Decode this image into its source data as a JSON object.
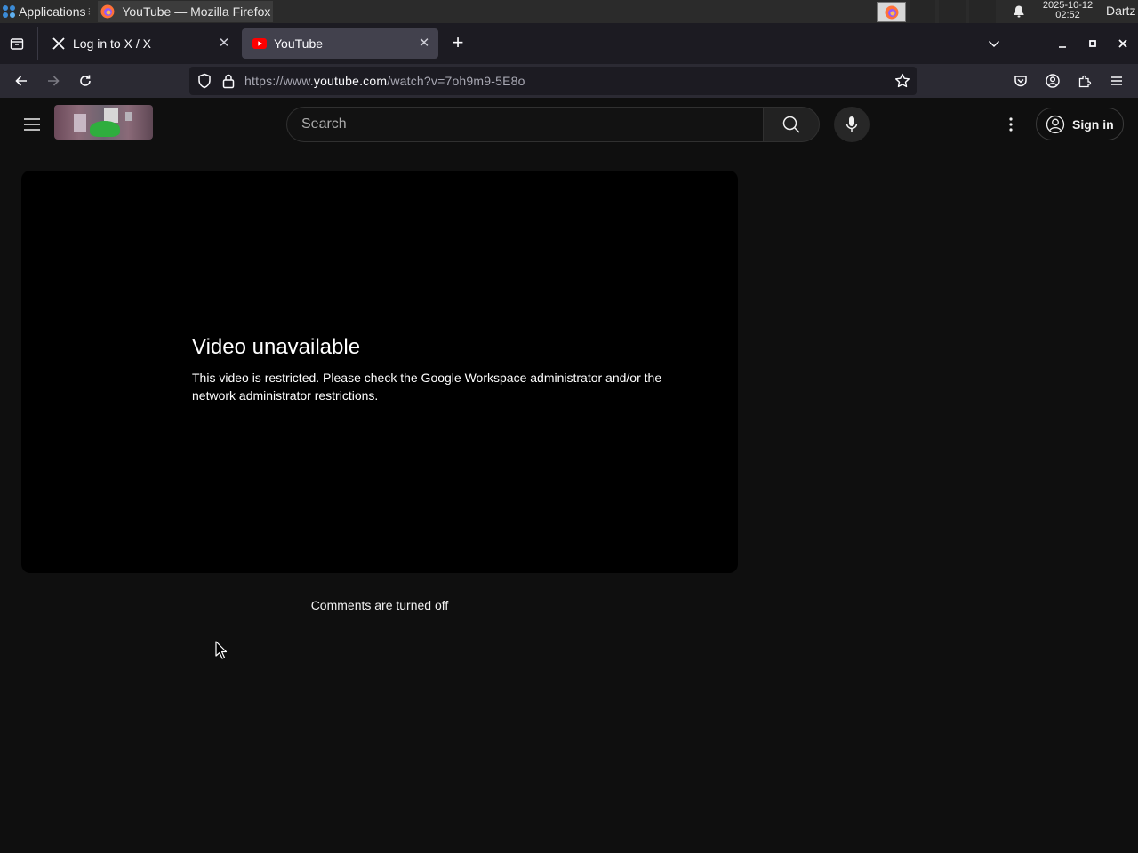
{
  "taskbar": {
    "applications_label": "Applications",
    "applications_sep": "⁝",
    "window_title": "YouTube — Mozilla Firefox",
    "clock_date": "2025-10-12",
    "clock_time": "02:52",
    "user": "Dartz"
  },
  "tabs": [
    {
      "title": "Log in to X / X",
      "active": false,
      "icon": "x-logo-icon"
    },
    {
      "title": "YouTube",
      "active": true,
      "icon": "youtube-favicon-icon"
    }
  ],
  "navbar": {
    "url_prefix": "https://www.",
    "url_host": "youtube.com",
    "url_path": "/watch?v=7oh9m9-5E8o"
  },
  "youtube": {
    "search_placeholder": "Search",
    "sign_in_label": "Sign in",
    "error_title": "Video unavailable",
    "error_message": "This video is restricted. Please check the Google Workspace administrator and/or the network administrator restrictions.",
    "comments_status": "Comments are turned off"
  },
  "colors": {
    "page_bg": "#0f0f0f",
    "player_bg": "#000000",
    "tabstrip_bg": "#1c1b22",
    "navbar_bg": "#2b2a33",
    "active_tab_bg": "#42414d",
    "youtube_red": "#ff0000"
  }
}
